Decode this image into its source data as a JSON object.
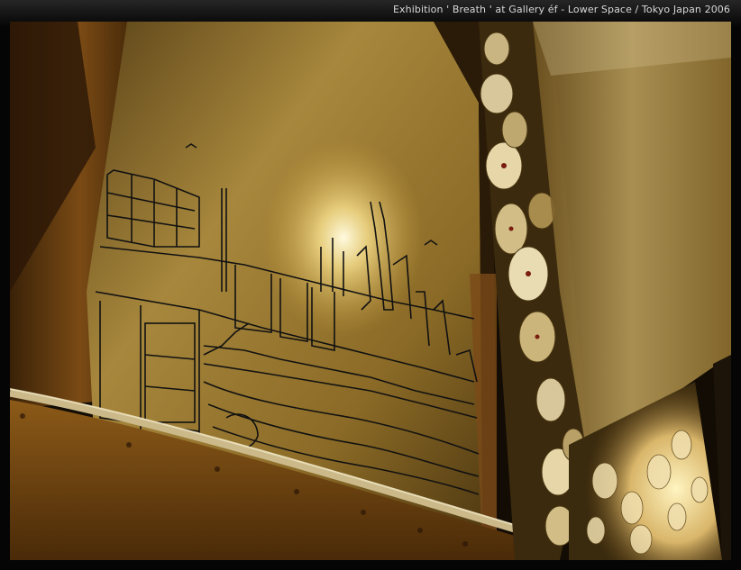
{
  "caption": "Exhibition  ' Breath '  at  Gallery éf - Lower Space  /   Tokyo Japan   2006",
  "photo": {
    "subject": "Installation view: ink-drawn industrial harbor cityscape on a curved golden metallic panel, with a column of hanging circular discs on the right",
    "colors": {
      "panel_gold": "#b8913d",
      "highlight": "#fff6cc",
      "shadow": "#1a1206",
      "ink": "#111111",
      "frame": "#0a0a0a"
    }
  }
}
